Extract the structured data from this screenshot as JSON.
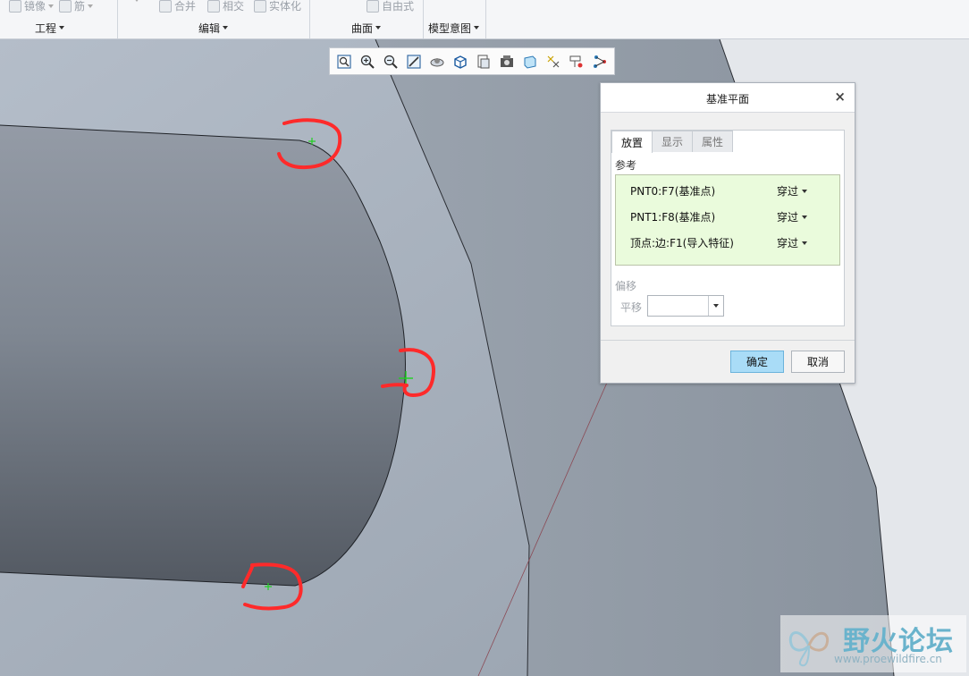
{
  "ribbon": {
    "top_buttons": [
      "镜像",
      "筋",
      "合并",
      "相交",
      "实体化",
      "自由式"
    ],
    "groups": [
      {
        "label": "工程"
      },
      {
        "label": "编辑"
      },
      {
        "label": "曲面"
      },
      {
        "label": "模型意图"
      }
    ]
  },
  "view_toolbar": {
    "icons": [
      "zoom-fit-icon",
      "zoom-in-icon",
      "zoom-out-icon",
      "repaint-icon",
      "spin-center-icon",
      "display-style-icon",
      "saved-views-icon",
      "view-manager-icon",
      "perspective-icon",
      "datum-display-icon",
      "annotation-display-icon",
      "spin-icon"
    ]
  },
  "dialog": {
    "title": "基准平面",
    "close": "×",
    "tabs": [
      {
        "label": "放置",
        "active": true
      },
      {
        "label": "显示",
        "active": false
      },
      {
        "label": "属性",
        "active": false
      }
    ],
    "references_label": "参考",
    "references": [
      {
        "name": "PNT0:F7(基准点)",
        "constraint": "穿过"
      },
      {
        "name": "PNT1:F8(基准点)",
        "constraint": "穿过"
      },
      {
        "name": "顶点:边:F1(导入特征)",
        "constraint": "穿过"
      }
    ],
    "offset_label": "偏移",
    "translate_label": "平移",
    "translate_value": "",
    "ok": "确定",
    "cancel": "取消"
  },
  "watermark": {
    "title": "野火论坛",
    "url": "www.proewildfire.cn"
  },
  "colors": {
    "ok_button": "#a9dcf7",
    "reference_box": "#eafbdc",
    "annotation_marks": "#ff2a2a",
    "point_marker": "#1fd11f"
  }
}
